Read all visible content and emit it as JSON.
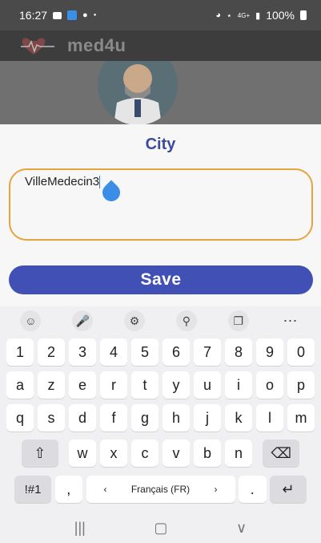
{
  "status_bar": {
    "time": "16:27",
    "battery": "100%",
    "left_icons": [
      "image-icon",
      "app-icon",
      "android-icon",
      "dot-icon"
    ],
    "right_icons": [
      "nfc-icon",
      "wifi-icon",
      "4g-icon",
      "signal-icon",
      "battery-icon"
    ]
  },
  "app_bar": {
    "title": "med4u"
  },
  "sheet": {
    "title": "City",
    "input_value": "VilleMedecin3",
    "save_label": "Save"
  },
  "keyboard": {
    "toolbar": [
      "emoji-icon",
      "mic-icon",
      "settings-icon",
      "search-icon",
      "clipboard-icon",
      "more-icon"
    ],
    "rows": [
      [
        "1",
        "2",
        "3",
        "4",
        "5",
        "6",
        "7",
        "8",
        "9",
        "0"
      ],
      [
        "a",
        "z",
        "e",
        "r",
        "t",
        "y",
        "u",
        "i",
        "o",
        "p"
      ],
      [
        "q",
        "s",
        "d",
        "f",
        "g",
        "h",
        "j",
        "k",
        "l",
        "m"
      ],
      [
        "w",
        "x",
        "c",
        "v",
        "b",
        "n"
      ]
    ],
    "symbols_label": "!#1",
    "comma_label": ",",
    "space_label": "Français (FR)",
    "period_label": ".",
    "space_left_arrow": "‹",
    "space_right_arrow": "›"
  },
  "colors": {
    "accent": "#4050b5",
    "input_border": "#e8a33d",
    "title": "#3b4a9b"
  }
}
